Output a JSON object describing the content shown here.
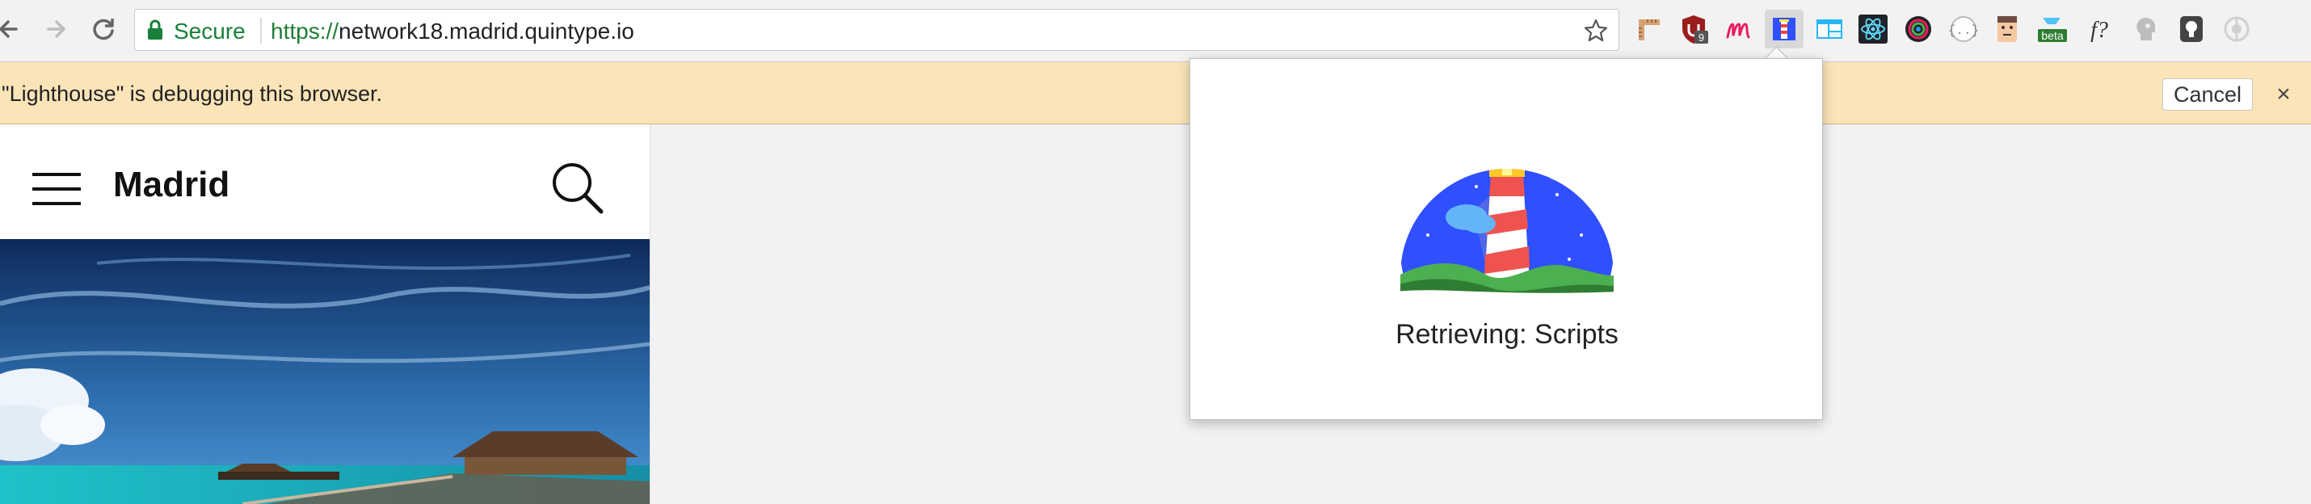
{
  "browser": {
    "secure_label": "Secure",
    "url_scheme": "https://",
    "url_host": "network18.madrid.quintype.io",
    "icons": {
      "back": "back-arrow-icon",
      "forward": "forward-arrow-icon",
      "reload": "reload-icon",
      "lock": "lock-icon",
      "bookmark": "star-icon"
    },
    "extensions": [
      "ruler-extension-icon",
      "ublock-extension-icon",
      "m-extension-icon",
      "lighthouse-extension-icon",
      "window-extension-icon",
      "react-devtools-icon",
      "color-picker-icon",
      "json-extension-icon",
      "face-extension-icon",
      "beta-extension-icon",
      "fonts-extension-icon",
      "head-extension-icon",
      "bulb-extension-icon",
      "disabled-extension-icon"
    ],
    "ublock_badge": "9",
    "beta_badge": "beta",
    "fonts_label": "f?"
  },
  "infobar": {
    "message": "\"Lighthouse\" is debugging this browser.",
    "cancel_label": "Cancel",
    "close_label": "×"
  },
  "site": {
    "title": "Madrid"
  },
  "popup": {
    "status": "Retrieving: Scripts"
  },
  "colors": {
    "secure_green": "#188038",
    "infobar_bg": "#fbe4b8",
    "lighthouse_blue": "#304ffe",
    "lighthouse_red": "#f44336",
    "ground_green": "#4caf50"
  }
}
